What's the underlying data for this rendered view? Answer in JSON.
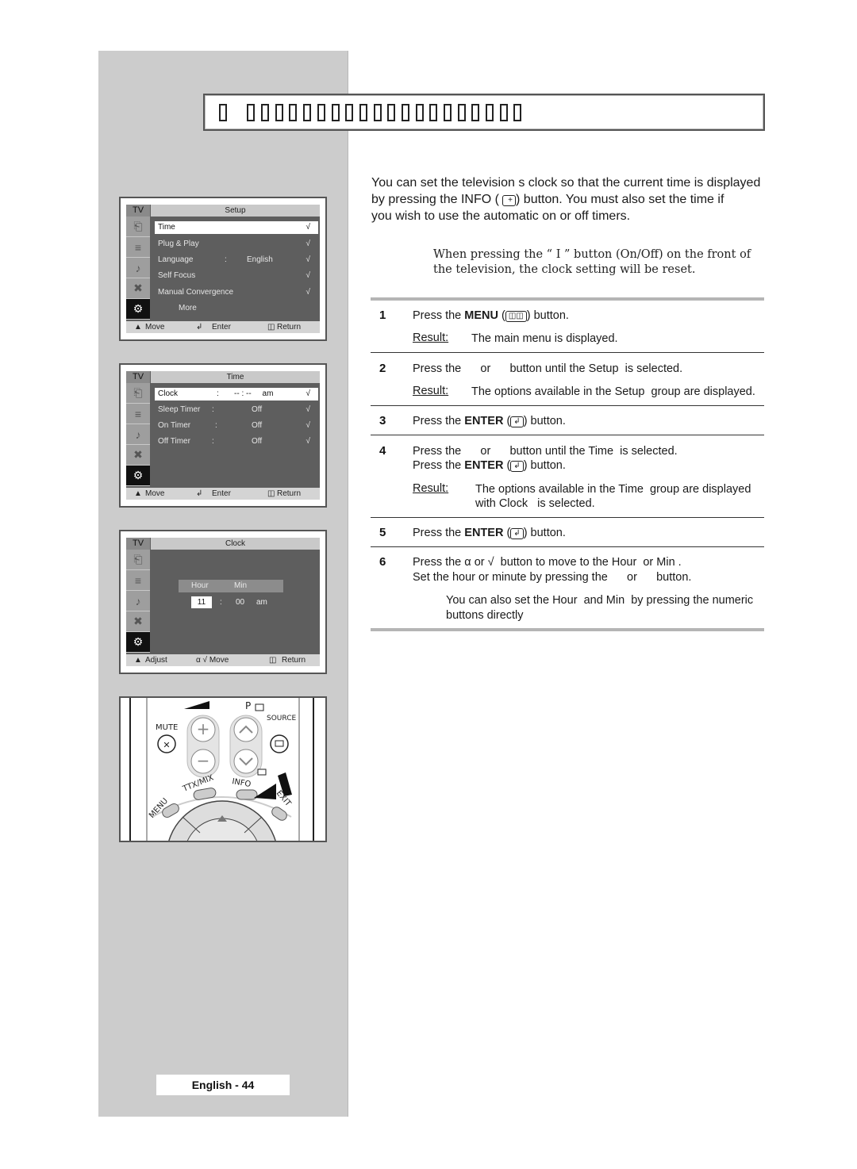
{
  "page": {
    "title_glyph_count": 22,
    "page_number_label": "English - 44"
  },
  "intro": {
    "paragraph": "You can set the television s clock so that the current time is displayed by pressing the INFO (  ) button. You must also set the time if you wish to use the automatic on or off timers.",
    "line1": "You can set the television s clock so that the current time is displayed",
    "line2_pre": "by pressing the INFO (",
    "line2_post": ")  button. You must also set the time if",
    "line3": "you wish to use the automatic on or off timers."
  },
  "note": {
    "line1": "When pressing the “ I ” button (On/Off) on the front of",
    "line2": "the television, the clock setting will be reset."
  },
  "steps": [
    {
      "num": "1",
      "text_pre": "Press the ",
      "bold": "MENU",
      "text_post": " (",
      "icon": "menu-icon",
      "after": ")  button.",
      "result_label": "Result:",
      "result": "The main menu is displayed."
    },
    {
      "num": "2",
      "text": "Press the      or      button until the Setup  is selected.",
      "result_label": "Result:",
      "result": "The options available in the Setup  group are displayed."
    },
    {
      "num": "3",
      "text_pre": "Press the ",
      "bold": "ENTER",
      "text_post": " (",
      "icon": "enter-icon",
      "after": ") button."
    },
    {
      "num": "4",
      "text": "Press the      or      button until the Time  is selected.",
      "text2_pre": "Press the ",
      "bold": "ENTER",
      "text2_post": " (",
      "after": ") button.",
      "result_label": "Result:",
      "result_line1": "The options available in the Time  group are displayed",
      "result_line2": "with Clock   is selected."
    },
    {
      "num": "5",
      "text_pre": "Press the ",
      "bold": "ENTER",
      "text_post": " (",
      "icon": "enter-icon",
      "after": ") button."
    },
    {
      "num": "6",
      "text": "Press the α or √  button to move to the Hour  or Min .",
      "text2": "Set the hour or minute by pressing the      or      button.",
      "tip_line1": "You can also set the Hour  and Min  by pressing the numeric",
      "tip_line2": "buttons directly"
    }
  ],
  "osd_screens": [
    {
      "tv_label": "TV",
      "title": "Setup",
      "rows": [
        {
          "label": "Time",
          "sep": "",
          "value": "",
          "check": "√",
          "selected": true
        },
        {
          "label": "Plug & Play",
          "sep": "",
          "value": "",
          "check": "√"
        },
        {
          "label": "Language",
          "sep": ":",
          "value": "English",
          "check": "√"
        },
        {
          "label": "Self Focus",
          "sep": "",
          "value": "",
          "check": "√"
        },
        {
          "label": "Manual Convergence",
          "sep": "",
          "value": "",
          "check": "√"
        },
        {
          "label": "More",
          "sep": "",
          "value": "",
          "check": ""
        }
      ],
      "footer": {
        "left": "Move",
        "middle": "Enter",
        "right": "Return"
      }
    },
    {
      "tv_label": "TV",
      "title": "Time",
      "rows": [
        {
          "label": "Clock",
          "sep": ":",
          "value": "-- : --     am",
          "check": "√",
          "selected": true
        },
        {
          "label": "Sleep Timer",
          "sep": ":",
          "value": "Off",
          "check": "√"
        },
        {
          "label": "On Timer",
          "sep": ":",
          "value": "Off",
          "check": "√"
        },
        {
          "label": "Off Timer",
          "sep": ":",
          "value": "Off",
          "check": "√"
        }
      ],
      "footer": {
        "left": "Move",
        "middle": "Enter",
        "right": "Return"
      }
    },
    {
      "tv_label": "TV",
      "title": "Clock",
      "clock": {
        "hour_label": "Hour",
        "min_label": "Min",
        "hour": "11",
        "sep": ":",
        "min": "00",
        "ampm": "am"
      },
      "footer": {
        "left": "Adjust",
        "middle": "α √ Move",
        "right": "Return"
      }
    }
  ],
  "remote": {
    "mute": "MUTE",
    "p": "P",
    "source": "SOURCE",
    "ttx": "TTX/MIX",
    "info": "INFO",
    "menu": "MENU",
    "exit": "EXIT"
  }
}
